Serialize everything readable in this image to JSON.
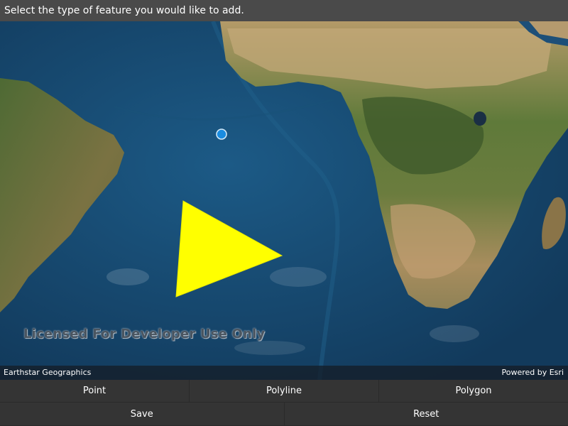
{
  "instruction": {
    "text": "Select the type of feature you would like to add."
  },
  "map": {
    "watermark": "Licensed For Developer Use Only",
    "attribution_left": "Earthstar Geographics",
    "attribution_right": "Powered by Esri",
    "ocean_color": "#16456b",
    "land_color": "#8a7a50",
    "point_color": "#1a8ce0",
    "polygon_color": "#ffff00"
  },
  "toolbar": {
    "point_label": "Point",
    "polyline_label": "Polyline",
    "polygon_label": "Polygon",
    "save_label": "Save",
    "reset_label": "Reset"
  }
}
